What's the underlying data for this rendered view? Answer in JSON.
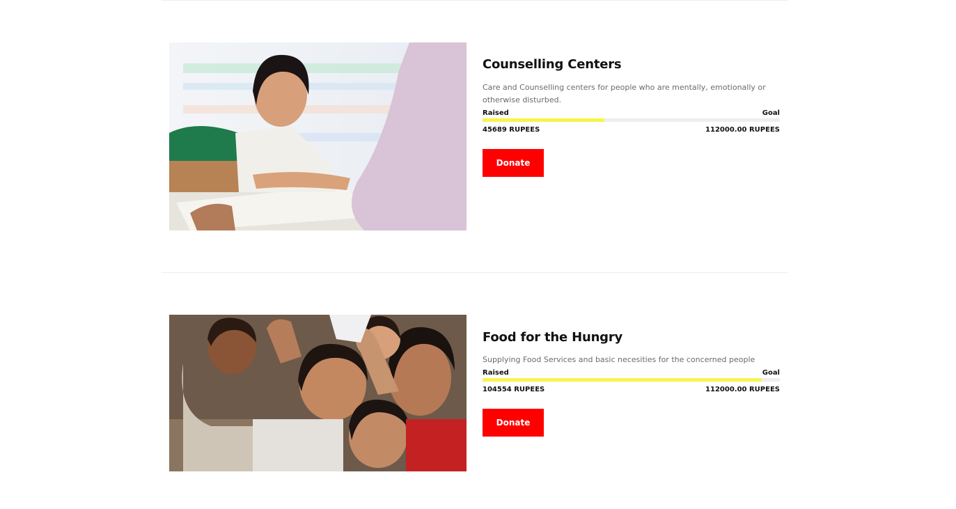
{
  "campaigns": [
    {
      "title": "Counselling Centers",
      "description": "Care and Counselling centers for people who are mentally, emotionally or otherwise disturbed.",
      "raised_label": "Raised",
      "goal_label": "Goal",
      "raised_amount": "45689 RUPEES",
      "goal_amount": "112000.00 RUPEES",
      "progress_fraction": 0.41,
      "donate_label": "Donate"
    },
    {
      "title": "Food for the Hungry",
      "description": "Supplying Food Services and basic necesities for the concerned people",
      "raised_label": "Raised",
      "goal_label": "Goal",
      "raised_amount": "104554 RUPEES",
      "goal_amount": "112000.00 RUPEES",
      "progress_fraction": 0.94,
      "donate_label": "Donate"
    }
  ],
  "colors": {
    "donate_button": "#ff0000",
    "progress_fill": "#f7f54b",
    "progress_track": "#eeeeee"
  }
}
